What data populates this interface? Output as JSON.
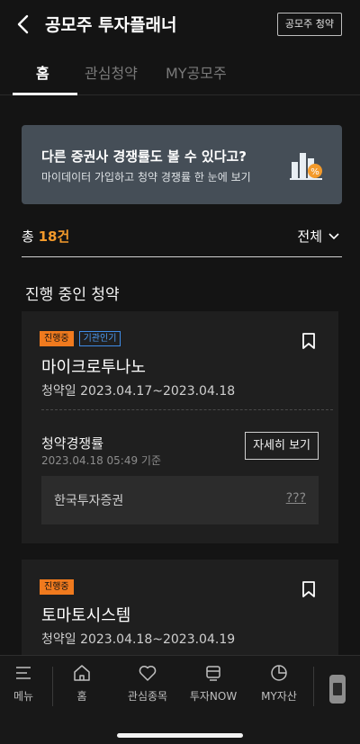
{
  "header": {
    "title": "공모주 투자플래너",
    "right_button": "공모주 청약"
  },
  "tabs": [
    {
      "label": "홈",
      "active": true
    },
    {
      "label": "관심청약",
      "active": false
    },
    {
      "label": "MY공모주",
      "active": false
    }
  ],
  "banner": {
    "title": "다른 증권사 경쟁률도 볼 수 있다고?",
    "subtitle": "마이데이터 가입하고 청약 경쟁률 한 눈에 보기",
    "icon": "chart-percent-icon"
  },
  "summary": {
    "total_prefix": "총",
    "total_count": "18건",
    "filter_label": "전체"
  },
  "section_title": "진행 중인 청약",
  "cards": [
    {
      "badges": [
        "진행중",
        "기관인기"
      ],
      "name": "마이크로투나노",
      "date": "청약일 2023.04.17~2023.04.18",
      "competition_title": "청약경쟁률",
      "competition_time": "2023.04.18 05:49 기준",
      "detail_button": "자세히 보기",
      "broker": "한국투자증권",
      "broker_value": "???"
    },
    {
      "badges": [
        "진행중"
      ],
      "name": "토마토시스템",
      "date": "청약일 2023.04.18~2023.04.19"
    }
  ],
  "bottom_nav": [
    {
      "label": "메뉴",
      "icon": "menu-icon"
    },
    {
      "label": "홈",
      "icon": "home-icon"
    },
    {
      "label": "관심종목",
      "icon": "heart-icon"
    },
    {
      "label": "투자NOW",
      "icon": "tv-icon"
    },
    {
      "label": "MY자산",
      "icon": "pie-chart-icon"
    }
  ],
  "colors": {
    "accent": "#f39a2b",
    "badge_orange": "#f07a1e",
    "badge_blue": "#4d9bf2",
    "banner_bg": "#454e57"
  }
}
